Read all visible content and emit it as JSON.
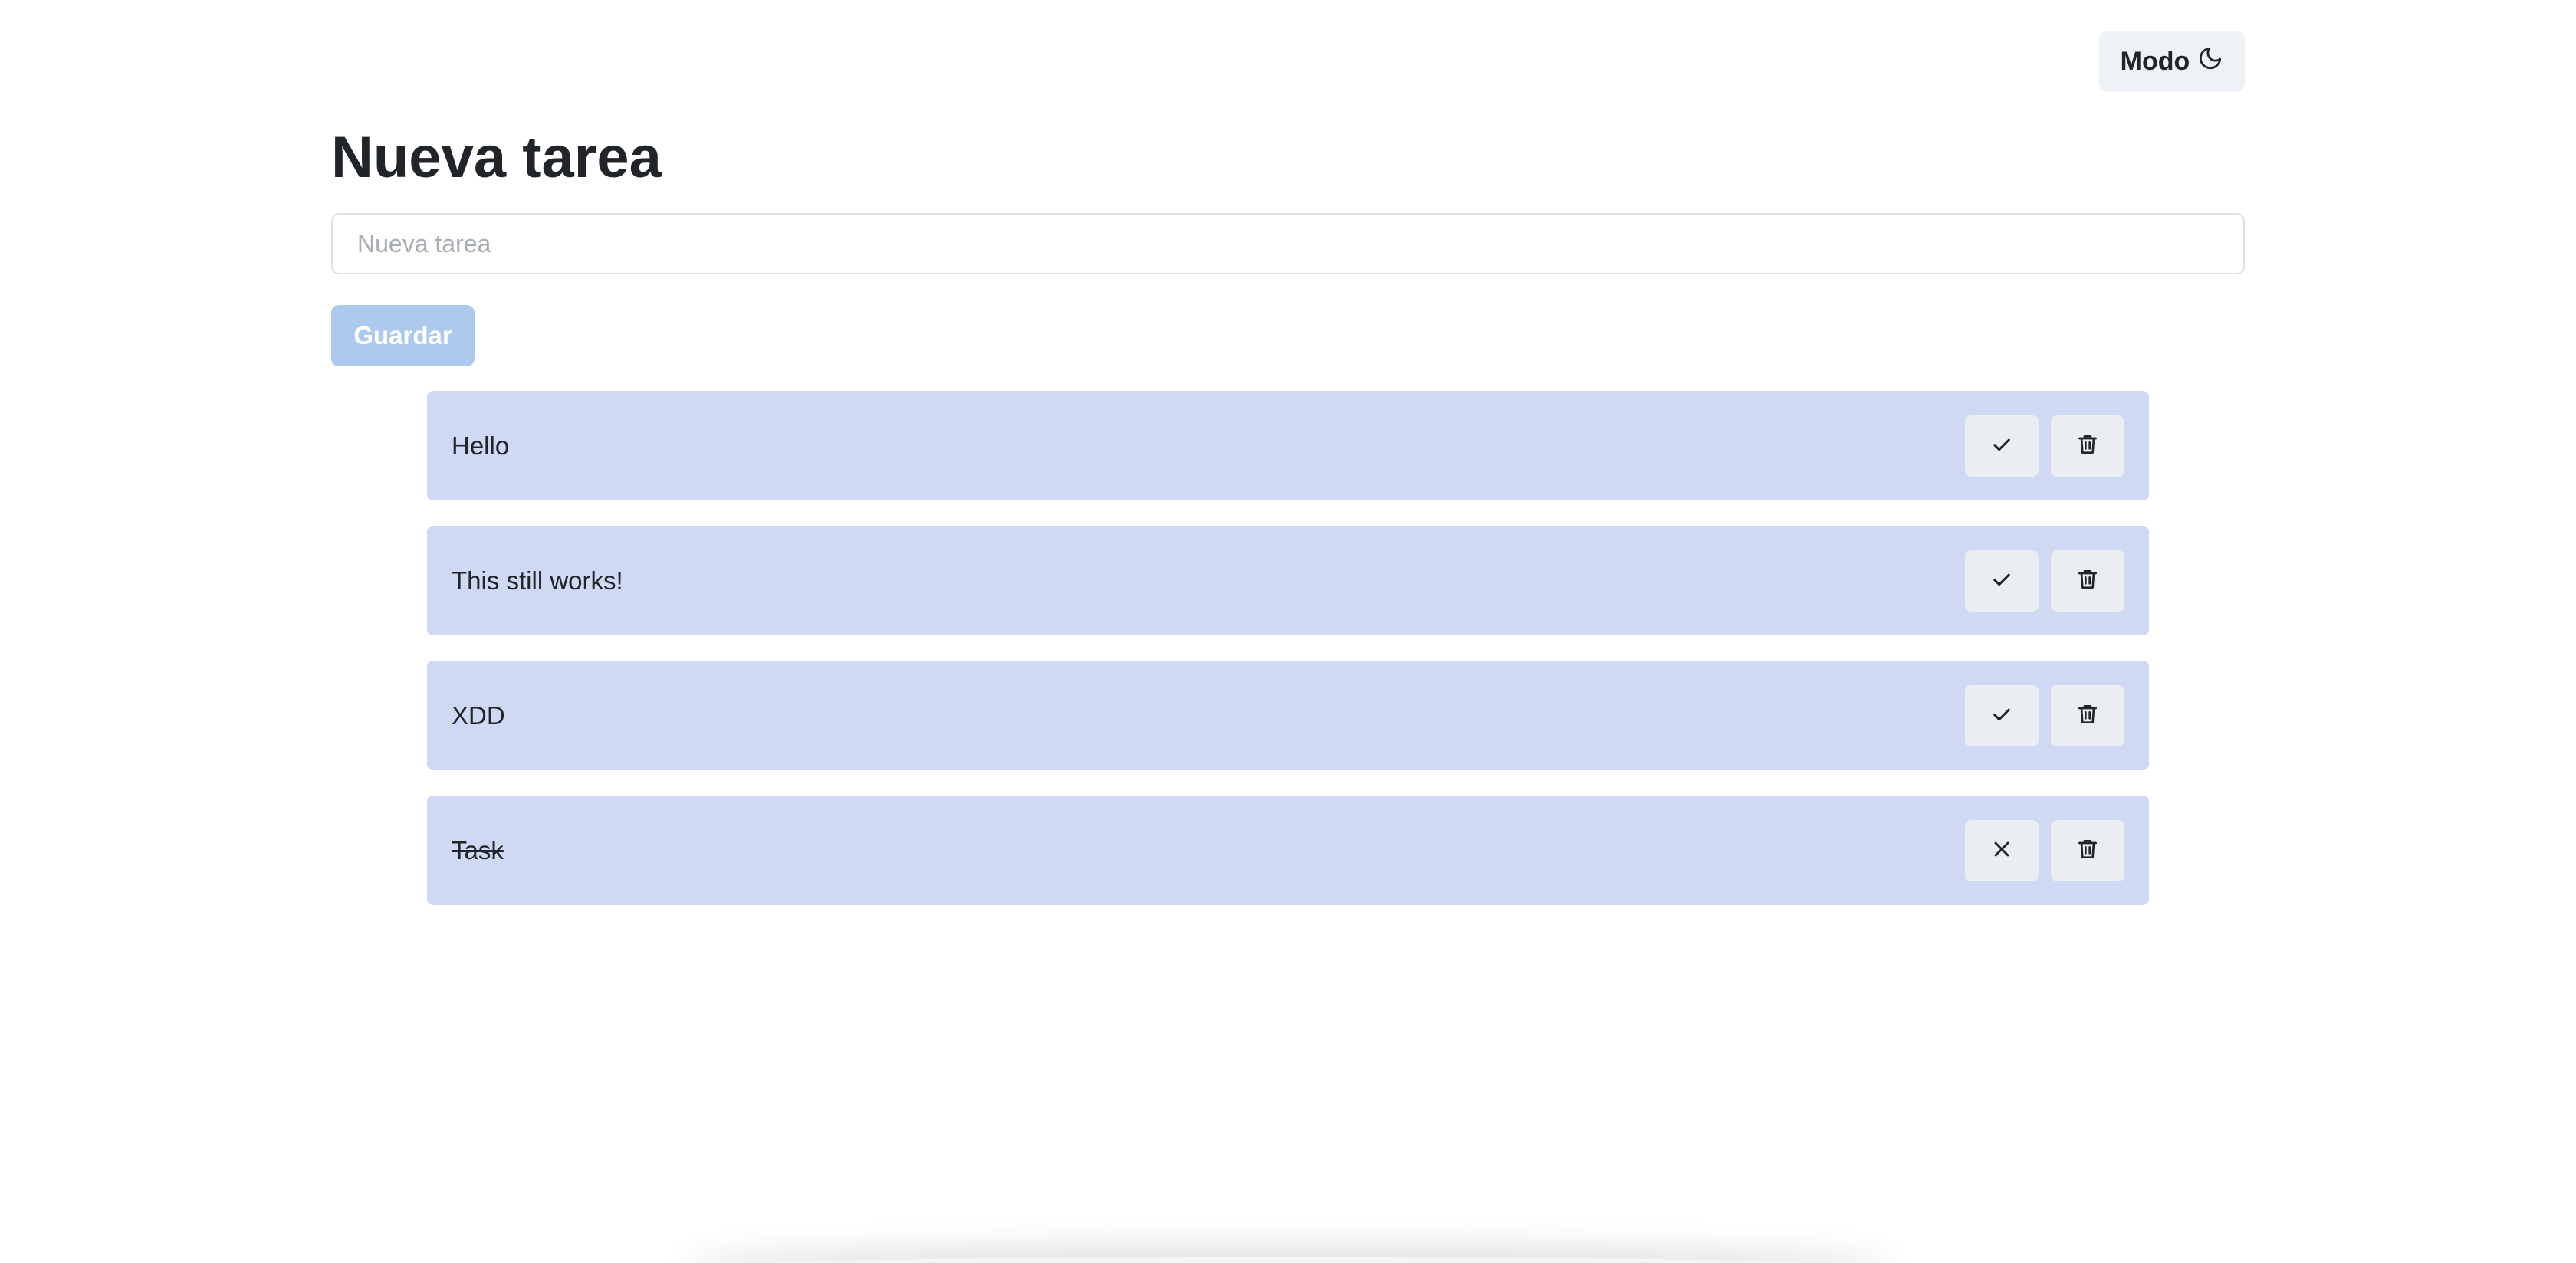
{
  "header": {
    "mode_label": "Modo",
    "mode_icon": "moon-icon"
  },
  "form": {
    "title": "Nueva tarea",
    "input_value": "",
    "input_placeholder": "Nueva tarea",
    "save_label": "Guardar"
  },
  "tasks": [
    {
      "text": "Hello",
      "completed": false,
      "toggle_icon": "check-icon",
      "delete_icon": "trash-icon"
    },
    {
      "text": "This still works!",
      "completed": false,
      "toggle_icon": "check-icon",
      "delete_icon": "trash-icon"
    },
    {
      "text": "XDD",
      "completed": false,
      "toggle_icon": "check-icon",
      "delete_icon": "trash-icon"
    },
    {
      "text": "Task",
      "completed": true,
      "toggle_icon": "close-icon",
      "delete_icon": "trash-icon"
    }
  ],
  "colors": {
    "task_background": "#cfd9f4",
    "button_background": "#eaeef3",
    "save_button_background": "#adc9ec",
    "text": "#212529"
  }
}
